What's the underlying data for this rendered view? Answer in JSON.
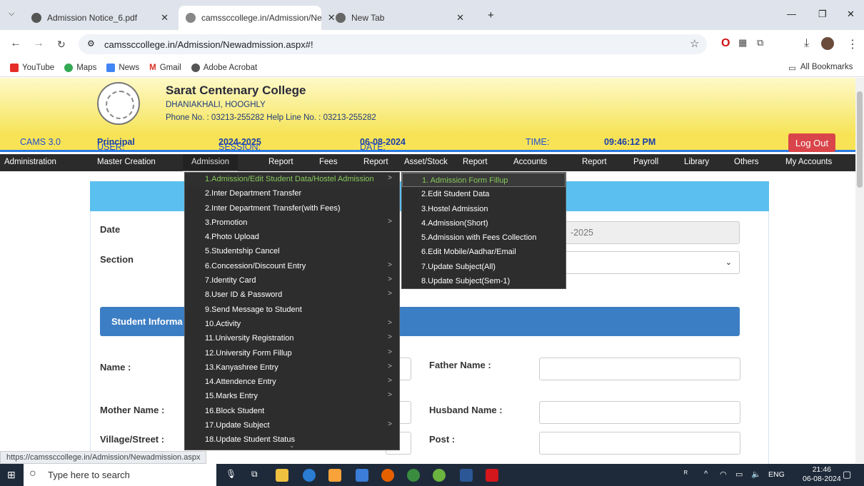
{
  "browser": {
    "tabs": [
      {
        "title": "Admission Notice_6.pdf"
      },
      {
        "title": "camssccollege.in/Admission/Ne"
      },
      {
        "title": "New Tab"
      }
    ],
    "new_tab": "+",
    "url": "camssccollege.in/Admission/Newadmission.aspx#!",
    "bookmarks": [
      "YouTube",
      "Maps",
      "News",
      "Gmail",
      "Adobe Acrobat"
    ],
    "all_bookmarks": "All Bookmarks",
    "status_url": "https://camssccollege.in/Admission/Newadmission.aspx"
  },
  "header": {
    "college_name": "Sarat Centenary College",
    "address": "DHANIAKHALI, HOOGHLY",
    "phone": "Phone No. : 03213-255282  Help Line No. : 03213-255282"
  },
  "infobar": {
    "cams": "CAMS 3.0",
    "user_label": "USER:",
    "user": "Principal",
    "session_label": "SESSION:",
    "session": "2024-2025",
    "date_label": "DATE:",
    "date": "06-08-2024",
    "time_label": "TIME:",
    "time": "09:46:12 PM",
    "logout": "Log Out"
  },
  "menubar": [
    "Administration",
    "Master Creation",
    "Admission",
    "Report",
    "Fees",
    "Report",
    "Asset/Stock",
    "Report",
    "Accounts",
    "Report",
    "Payroll",
    "Library",
    "Others",
    "My Accounts"
  ],
  "admission_menu": [
    {
      "label": "1.Admission/Edit Student Data/Hostel Admission",
      "sub": true
    },
    {
      "label": "2.Inter Department Transfer",
      "sub": false
    },
    {
      "label": "2.Inter Department Transfer(with Fees)",
      "sub": false
    },
    {
      "label": "3.Promotion",
      "sub": true
    },
    {
      "label": "4.Photo Upload",
      "sub": false
    },
    {
      "label": "5.Studentship Cancel",
      "sub": false
    },
    {
      "label": "6.Concession/Discount Entry",
      "sub": true
    },
    {
      "label": "7.Identity Card",
      "sub": true
    },
    {
      "label": "8.User ID & Password",
      "sub": true
    },
    {
      "label": "9.Send Message to Student",
      "sub": false
    },
    {
      "label": "10.Activity",
      "sub": true
    },
    {
      "label": "11.University Registration",
      "sub": true
    },
    {
      "label": "12.University Form Fillup",
      "sub": true
    },
    {
      "label": "13.Kanyashree Entry",
      "sub": true
    },
    {
      "label": "14.Attendence Entry",
      "sub": true
    },
    {
      "label": "15.Marks Entry",
      "sub": true
    },
    {
      "label": "16.Block Student",
      "sub": false
    },
    {
      "label": "17.Update Subject",
      "sub": true
    },
    {
      "label": "18.Update Student Status",
      "sub": false
    }
  ],
  "admission_submenu": [
    "1. Admission Form Fillup",
    "2.Edit Student Data",
    "3.Hostel Admission",
    "4.Admission(Short)",
    "5.Admission with Fees Collection",
    "6.Edit Mobile/Aadhar/Email",
    "7.Update Subject(All)",
    "8.Update Subject(Sem-1)"
  ],
  "form": {
    "date_label": "Date",
    "session_value": "-2025",
    "section_label": "Section",
    "student_info": "Student Informa",
    "name_label": "Name :",
    "father_label": "Father Name :",
    "mother_label": "Mother Name :",
    "husband_label": "Husband Name :",
    "village_label": "Village/Street :",
    "post_label": "Post :"
  },
  "taskbar": {
    "search_placeholder": "Type here to search",
    "lang": "ENG",
    "time": "21:46",
    "date": "06-08-2024"
  }
}
